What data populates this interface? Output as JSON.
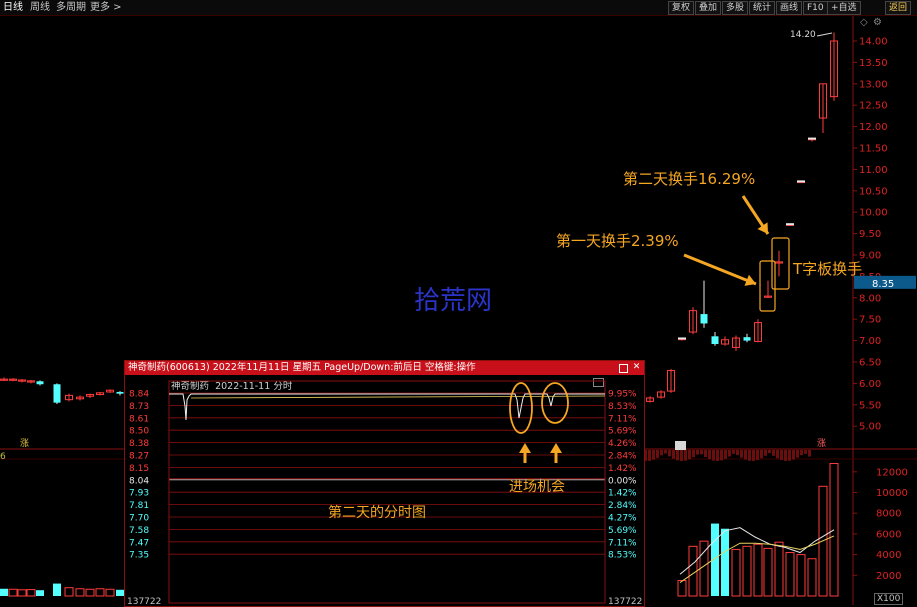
{
  "topbar": {
    "left_tabs": [
      "日线",
      "周线",
      "多周期",
      "更多 >"
    ],
    "right_tabs": [
      "复权",
      "叠加",
      "多股",
      "统计",
      "画线",
      "F10",
      "+自选",
      "返回"
    ],
    "right_tab_highlight": "返回"
  },
  "main_chart": {
    "price_ticks": [
      "14.00",
      "13.50",
      "13.00",
      "12.50",
      "12.00",
      "11.50",
      "11.00",
      "10.50",
      "10.00",
      "9.50",
      "9.00",
      "8.50",
      "8.00",
      "7.50",
      "7.00",
      "6.50",
      "6.00",
      "5.50",
      "5.00"
    ],
    "current_price_tag": "8.35",
    "high_label": "14.20",
    "volume_ticks": [
      "12000",
      "10000",
      "8000",
      "6000",
      "4000",
      "2000"
    ],
    "volume_unit": "X100",
    "watermark": "拾荒网",
    "left_tag": "涨",
    "right_tag": "涨",
    "bottom_left_mark": "6",
    "upper_right_icons": [
      "◇",
      "⚙"
    ]
  },
  "annotations": {
    "day2_turnover": "第二天换手16.29%",
    "day1_turnover": "第一天换手2.39%",
    "t_board": "T字板换手",
    "entry": "进场机会",
    "intraday": "第二天的分时图"
  },
  "popup": {
    "title": "神奇制药(600613) 2022年11月11日 星期五 PageUp/Down:前后日 空格键:操作",
    "subtitle_name": "神奇制药",
    "subtitle_date": "2022-11-11",
    "subtitle_kind": "分时",
    "left_ticks": [
      "8.84",
      "8.73",
      "8.61",
      "8.50",
      "8.38",
      "8.27",
      "8.15",
      "8.04",
      "7.93",
      "7.81",
      "7.70",
      "7.58",
      "7.47",
      "7.35"
    ],
    "right_ticks": [
      "9.95%",
      "8.53%",
      "7.11%",
      "5.69%",
      "4.26%",
      "2.84%",
      "1.42%",
      "0.00%",
      "1.42%",
      "2.84%",
      "4.27%",
      "5.69%",
      "7.11%",
      "8.53%"
    ],
    "bottom_left": "137722",
    "bottom_right": "137722",
    "base_price": "8.04",
    "base_pct": "0.00%"
  },
  "colors": {
    "up": "#ff3c3c",
    "down": "#54ffff",
    "accent": "#f5a623",
    "titlebar": "#c8101a",
    "watermark": "#2a34c8"
  },
  "chart_data": {
    "type": "candlestick",
    "y_axis": {
      "range": [
        4.7,
        14.3
      ],
      "label": ""
    },
    "volume_axis": {
      "range": [
        0,
        13000
      ]
    },
    "intraday": {
      "base": 8.04,
      "range": [
        7.35,
        8.84
      ],
      "limit_up": 8.84
    }
  }
}
